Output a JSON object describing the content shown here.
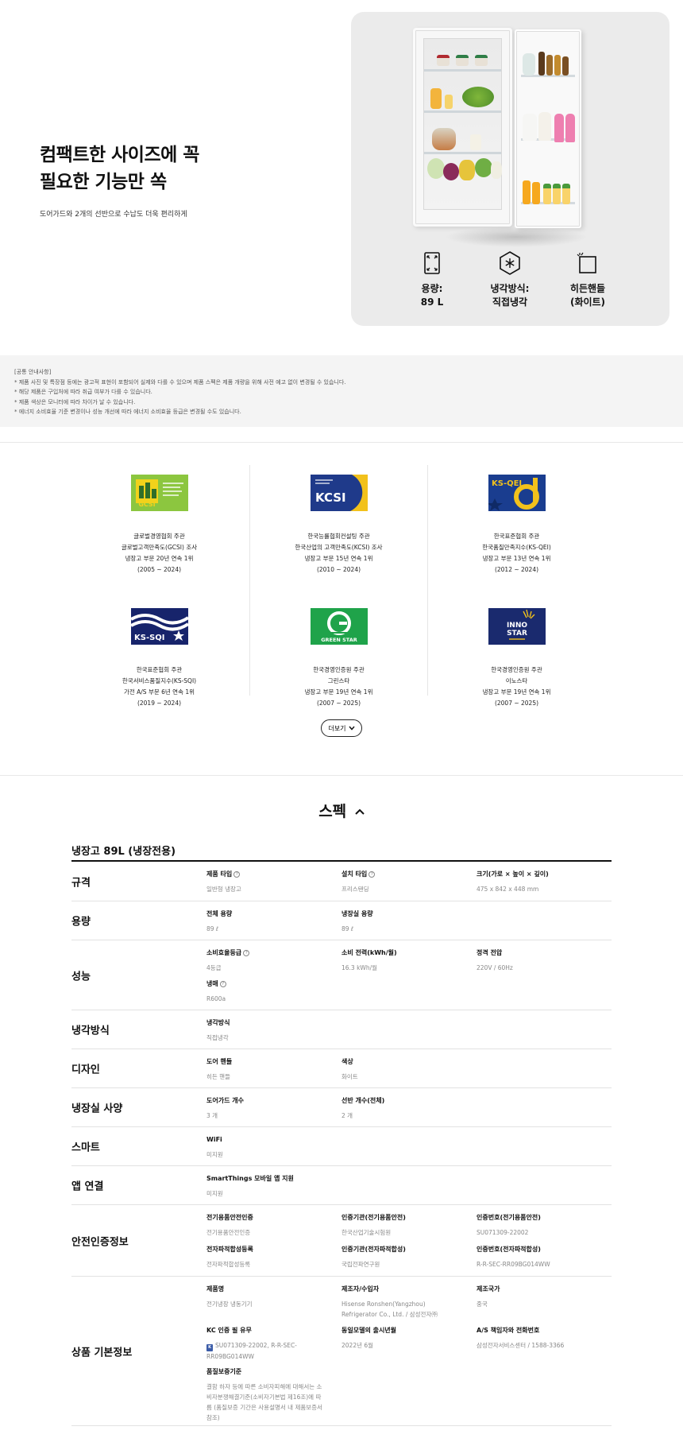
{
  "hero": {
    "title_line1": "컴팩트한 사이즈에 꼭",
    "title_line2": "필요한 기능만 쏙",
    "subtitle": "도어가드와 2개의 선반으로 수납도 더욱 편리하게",
    "specs": [
      {
        "icon": "resize-arrows-icon",
        "line1": "용량:",
        "line2": "89 L"
      },
      {
        "icon": "snowflake-hexagon-icon",
        "line1": "냉각방식:",
        "line2": "직접냉각"
      },
      {
        "icon": "hidden-handle-icon",
        "line1": "히든핸들",
        "line2": "(화이트)"
      }
    ]
  },
  "notice": {
    "lines": [
      "[공통 안내사항]",
      "* 제품 사진 및 특장점 등에는 광고적 표현이 포함되어 실제와 다를 수 있으며 제품 스펙은 제품 개량을 위해 사전 예고 없이 변경될 수 있습니다.",
      "* 해당 제품은 구입처에 따라 취급 여부가 다를 수 있습니다.",
      "* 제품 색상은 모니터에 따라 차이가 날 수 있습니다.",
      "* 에너지 소비효율 기준 변경이나 성능 개선에 따라 에너지 소비효율 등급은 변경될 수도 있습니다."
    ]
  },
  "awards": [
    {
      "logo": "GCSI",
      "lines": [
        "글로벌경영협회 주관",
        "글로벌고객만족도(GCSI) 조사",
        "냉장고 부문 20년 연속 1위",
        "(2005 ~ 2024)"
      ]
    },
    {
      "logo": "KCSI",
      "lines": [
        "한국능률협회컨설팅 주관",
        "한국산업의 고객만족도(KCSI) 조사",
        "냉장고 부문 15년 연속 1위",
        "(2010 ~ 2024)"
      ]
    },
    {
      "logo": "KS-QEI",
      "lines": [
        "한국표준협회 주관",
        "한국품질만족지수(KS-QEI)",
        "냉장고 부문 13년 연속 1위",
        "(2012 ~ 2024)"
      ]
    },
    {
      "logo": "KS-SQI",
      "lines": [
        "한국표준협회 주관",
        "한국서비스품질지수(KS-SQI)",
        "가전 A/S 부문 6년 연속 1위",
        "(2019 ~ 2024)"
      ]
    },
    {
      "logo": "GREEN STAR",
      "lines": [
        "한국경영인증원 주관",
        "그린스타",
        "냉장고 부문 19년 연속 1위",
        "(2007 ~ 2025)"
      ]
    },
    {
      "logo": "INNO STAR",
      "lines": [
        "한국경영인증원 주관",
        "이노스타",
        "냉장고 부문 19년 연속 1위",
        "(2007 ~ 2025)"
      ]
    }
  ],
  "more_button": "더보기",
  "spec": {
    "heading": "스펙",
    "model_title": "냉장고 89L (냉장전용)",
    "rows": [
      {
        "label": "규격",
        "cells": [
          {
            "key": "제품 타입",
            "help": true,
            "value": "일반형 냉장고"
          },
          {
            "key": "설치 타입",
            "help": true,
            "value": "프리스탠딩"
          },
          {
            "key": "크기(가로 × 높이 × 깊이)",
            "value": "475 x 842 x 448 mm"
          }
        ]
      },
      {
        "label": "용량",
        "cells": [
          {
            "key": "전체 용량",
            "value": "89 ℓ"
          },
          {
            "key": "냉장실 용량",
            "value": "89 ℓ"
          }
        ]
      },
      {
        "label": "성능",
        "cells": [
          {
            "key": "소비효율등급",
            "help": true,
            "value": "4등급"
          },
          {
            "key": "소비 전력(kWh/월)",
            "value": "16.3 kWh/월"
          },
          {
            "key": "정격 전압",
            "value": "220V / 60Hz"
          },
          {
            "key": "냉매",
            "help": true,
            "value": "R600a"
          }
        ]
      },
      {
        "label": "냉각방식",
        "cells": [
          {
            "key": "냉각방식",
            "value": "직접냉각"
          }
        ]
      },
      {
        "label": "디자인",
        "cells": [
          {
            "key": "도어 핸들",
            "value": "히든 핸들"
          },
          {
            "key": "색상",
            "value": "화이트"
          }
        ]
      },
      {
        "label": "냉장실 사양",
        "cells": [
          {
            "key": "도어가드 개수",
            "value": "3 개"
          },
          {
            "key": "선반 개수(전체)",
            "value": "2 개"
          }
        ]
      },
      {
        "label": "스마트",
        "cells": [
          {
            "key": "WiFi",
            "value": "미지원"
          }
        ]
      },
      {
        "label": "앱 연결",
        "cells": [
          {
            "key": "SmartThings 모바일 앱 지원",
            "value": "미지원"
          }
        ]
      },
      {
        "label": "안전인증정보",
        "cells": [
          {
            "key": "전기용품안전인증",
            "value": "전기용품안전인증"
          },
          {
            "key": "인증기관(전기용품안전)",
            "value": "한국산업기술시험원"
          },
          {
            "key": "인증번호(전기용품안전)",
            "value": "SU071309-22002"
          },
          {
            "key": "전자파적합성등록",
            "value": "전자파적합성등록"
          },
          {
            "key": "인증기관(전자파적합성)",
            "value": "국립전파연구원"
          },
          {
            "key": "인증번호(전자파적합성)",
            "value": "R-R-SEC-RR09BG014WW"
          }
        ]
      },
      {
        "label": "상품 기본정보",
        "cells": [
          {
            "key": "제품명",
            "value": "전기냉장 냉동기기"
          },
          {
            "key": "제조자/수입자",
            "value": "Hisense Ronshen(Yangzhou) Refrigerator Co., Ltd. / 삼성전자㈜"
          },
          {
            "key": "제조국가",
            "value": "중국"
          },
          {
            "key": "KC 인증 필 유무",
            "value": "SU071309-22002, R-R-SEC-RR09BG014WW"
          },
          {
            "key": "동일모델의 출시년월",
            "value": "2022년 6월"
          },
          {
            "key": "A/S 책임자와 전화번호",
            "value": "삼성전자서비스센터 / 1588-3366"
          },
          {
            "key": "품질보증기준",
            "value": "결함 하자 등에 따른 소비자피해에 대해서는 소비자분쟁해결기준(소비자기본법 제16조)에 따름 (품질보증 기간은 사용설명서 내 제품보증서 참조)"
          }
        ]
      }
    ]
  },
  "colors": {
    "hero_card_bg": "#ebebeb",
    "notice_bg": "#f4f4f4",
    "gcsi_green": "#8cc63f",
    "kcsi_navy": "#1f3a8a",
    "ks_qei_blue": "#1a3d8f",
    "ks_sqi_navy": "#17246b",
    "green_star": "#1fa34a",
    "inno_star_navy": "#1a2a6e"
  }
}
